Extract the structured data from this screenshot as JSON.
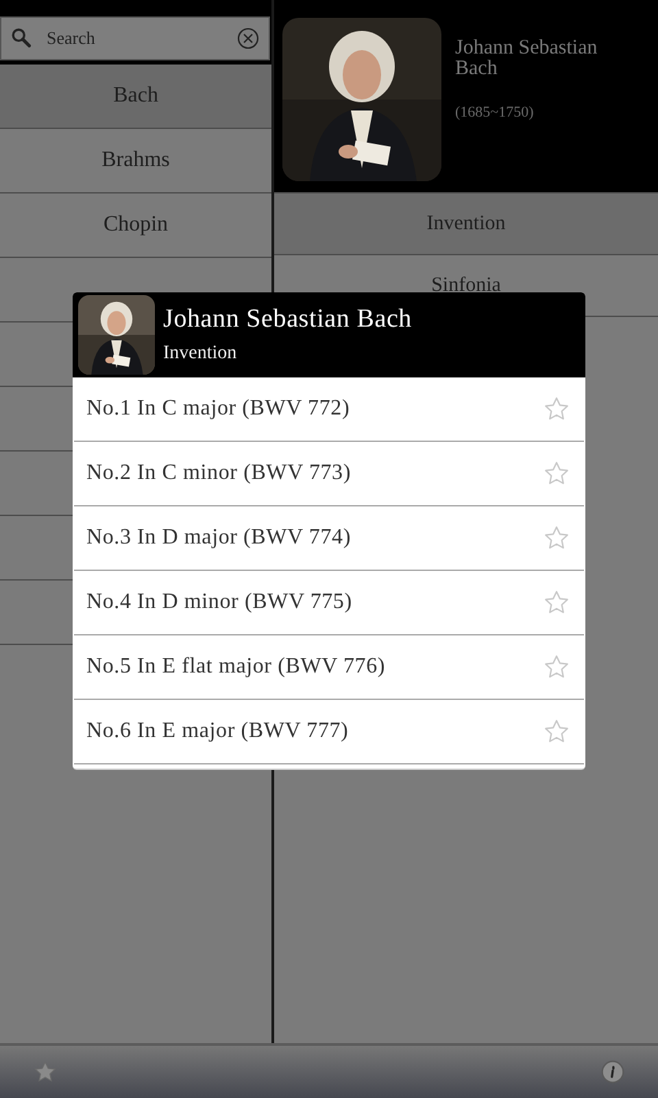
{
  "search": {
    "placeholder": "Search"
  },
  "composers": [
    {
      "name": "Bach",
      "selected": true
    },
    {
      "name": "Brahms",
      "selected": false
    },
    {
      "name": "Chopin",
      "selected": false
    }
  ],
  "composer": {
    "name": "Johann Sebastian Bach",
    "dates": "(1685~1750)"
  },
  "categories": [
    {
      "name": "Invention",
      "selected": true
    },
    {
      "name": "Sinfonia",
      "selected": false
    }
  ],
  "dialog": {
    "title": "Johann Sebastian Bach",
    "subtitle": "Invention",
    "pieces": [
      {
        "title": "No.1 In C major (BWV 772)",
        "favorite": false
      },
      {
        "title": "No.2 In C minor (BWV 773)",
        "favorite": false
      },
      {
        "title": "No.3 In D major (BWV 774)",
        "favorite": false
      },
      {
        "title": "No.4 In D minor (BWV 775)",
        "favorite": false
      },
      {
        "title": "No.5 In E flat major (BWV 776)",
        "favorite": false
      },
      {
        "title": "No.6 In E major (BWV 777)",
        "favorite": false
      }
    ]
  }
}
